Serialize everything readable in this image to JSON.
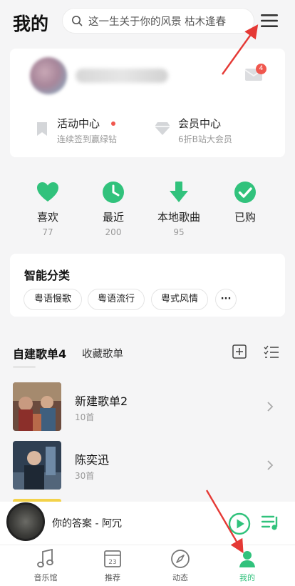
{
  "header": {
    "title": "我的",
    "search_placeholder": "这一生关于你的风景 枯木逢春"
  },
  "account": {
    "mail_badge": "4",
    "activity": {
      "title": "活动中心",
      "desc": "连续签到赢绿钻"
    },
    "vip": {
      "title": "会员中心",
      "desc": "6折B站大会员"
    }
  },
  "quick_actions": [
    {
      "label": "喜欢",
      "count": "77",
      "icon": "heart-icon"
    },
    {
      "label": "最近",
      "count": "200",
      "icon": "clock-icon"
    },
    {
      "label": "本地歌曲",
      "count": "95",
      "icon": "download-icon"
    },
    {
      "label": "已购",
      "count": "",
      "icon": "check-icon"
    }
  ],
  "smart_category": {
    "title": "智能分类",
    "chips": [
      "粤语慢歌",
      "粤语流行",
      "粤式风情"
    ],
    "more": "···"
  },
  "playlists": {
    "tab_active": "自建歌单4",
    "tab_other": "收藏歌单",
    "items": [
      {
        "name": "新建歌单2",
        "count": "10首"
      },
      {
        "name": "陈奕迅",
        "count": "30首"
      }
    ]
  },
  "player": {
    "song": "你的答案 - 阿冗"
  },
  "nav": {
    "items": [
      {
        "label": "音乐馆",
        "icon": "music-note-icon"
      },
      {
        "label": "推荐",
        "icon": "calendar-icon",
        "day": "23"
      },
      {
        "label": "动态",
        "icon": "compass-icon"
      },
      {
        "label": "我的",
        "icon": "profile-icon",
        "active": true
      }
    ]
  },
  "colors": {
    "accent": "#31c27c",
    "badge": "#f0574e",
    "annotation_arrow": "#e53935"
  }
}
